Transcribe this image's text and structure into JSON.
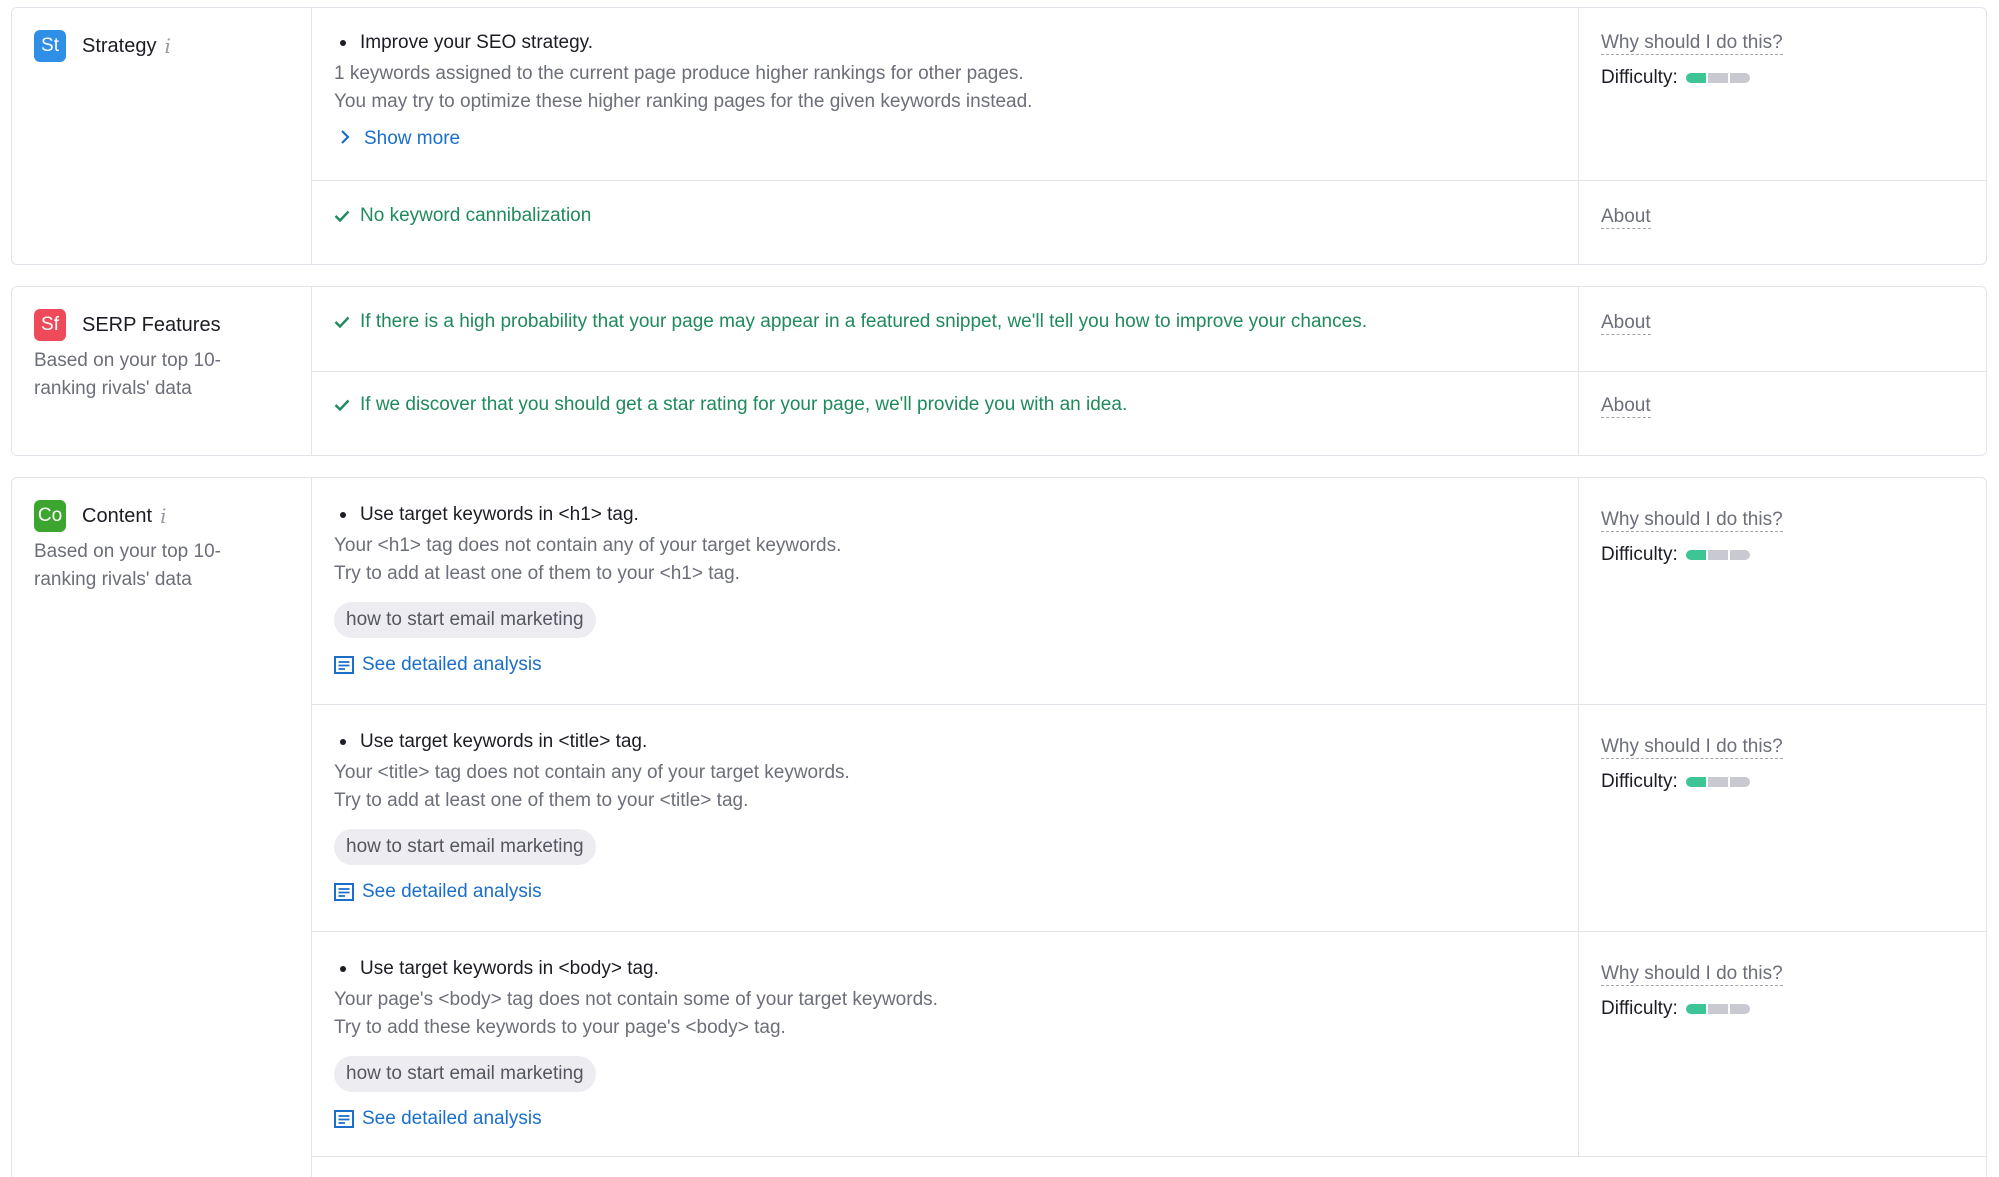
{
  "colors": {
    "strategy": "#2f8ee6",
    "serp": "#ef4a5a",
    "content": "#3ba52f",
    "link": "#1b6fca",
    "success": "#1f8a5c",
    "difficulty_on": "#3ec595"
  },
  "strategy": {
    "badge": "St",
    "title": "Strategy",
    "info": "i",
    "issue": {
      "title": "Improve your SEO strategy.",
      "desc1": "1 keywords assigned to the current page produce higher rankings for other pages.",
      "desc2": "You may try to optimize these higher ranking pages for the given keywords instead.",
      "show_more": "Show more",
      "why": "Why should I do this?",
      "difficulty_label": "Difficulty:",
      "difficulty_level": 1,
      "difficulty_max": 3
    },
    "ok": {
      "text": "No keyword cannibalization",
      "about": "About"
    }
  },
  "serp": {
    "badge": "Sf",
    "title": "SERP Features",
    "subtitle": "Based on your top 10-ranking rivals' data",
    "items": [
      {
        "text": "If there is a high probability that your page may appear in a featured snippet, we'll tell you how to improve your chances.",
        "about": "About"
      },
      {
        "text": "If we discover that you should get a star rating for your page, we'll provide you with an idea.",
        "about": "About"
      }
    ]
  },
  "content": {
    "badge": "Co",
    "title": "Content",
    "info": "i",
    "subtitle": "Based on your top 10-ranking rivals' data",
    "issues": [
      {
        "title": "Use target keywords in <h1> tag.",
        "desc1": "Your <h1> tag does not contain any of your target keywords.",
        "desc2": "Try to add at least one of them to your <h1> tag.",
        "keyword": "how to start email marketing",
        "link": "See detailed analysis",
        "why": "Why should I do this?",
        "difficulty_label": "Difficulty:",
        "difficulty_level": 1,
        "difficulty_max": 3
      },
      {
        "title": "Use target keywords in <title> tag.",
        "desc1": "Your <title> tag does not contain any of your target keywords.",
        "desc2": "Try to add at least one of them to your <title> tag.",
        "keyword": "how to start email marketing",
        "link": "See detailed analysis",
        "why": "Why should I do this?",
        "difficulty_label": "Difficulty:",
        "difficulty_level": 1,
        "difficulty_max": 3
      },
      {
        "title": "Use target keywords in <body> tag.",
        "desc1": "Your page's <body> tag does not contain some of your target keywords.",
        "desc2": "Try to add these keywords to your page's <body> tag.",
        "keyword": "how to start email marketing",
        "link": "See detailed analysis",
        "why": "Why should I do this?",
        "difficulty_label": "Difficulty:",
        "difficulty_level": 1,
        "difficulty_max": 3
      }
    ]
  }
}
